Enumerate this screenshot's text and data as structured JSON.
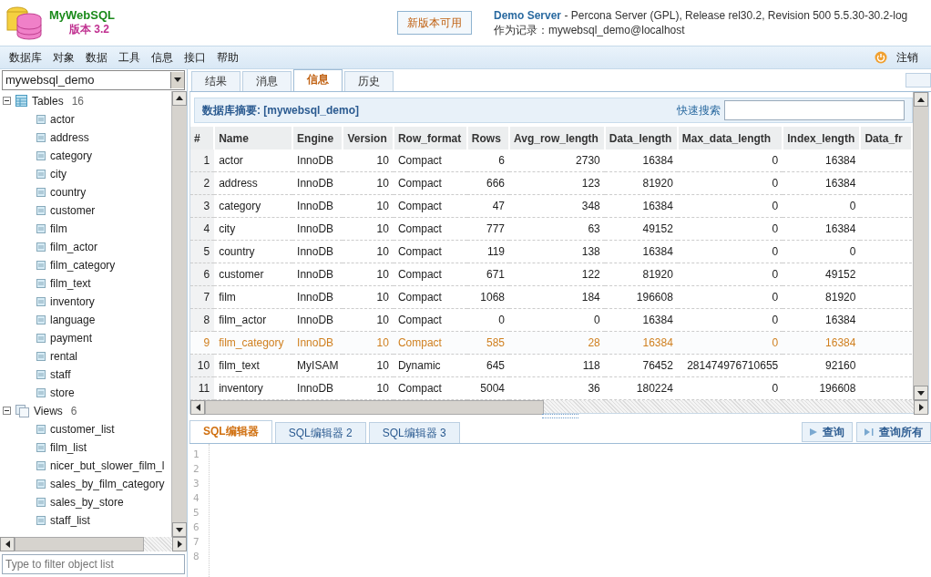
{
  "header": {
    "app_name": "MyWebSQL",
    "version": "版本 3.2",
    "update_button": "新版本可用",
    "server_name": "Demo Server",
    "server_info": "- Percona Server (GPL), Release rel30.2, Revision 500 5.5.30-30.2-log",
    "login": "作为记录：mywebsql_demo@localhost"
  },
  "menu": {
    "items": [
      "数据库",
      "对象",
      "数据",
      "工具",
      "信息",
      "接口",
      "帮助"
    ],
    "logout": "注销"
  },
  "sidebar": {
    "database": "mywebsql_demo",
    "filter_placeholder": "Type to filter object list",
    "tree": [
      {
        "label": "Tables",
        "count": "16",
        "kind": "tables",
        "expanded": true,
        "children": [
          "actor",
          "address",
          "category",
          "city",
          "country",
          "customer",
          "film",
          "film_actor",
          "film_category",
          "film_text",
          "inventory",
          "language",
          "payment",
          "rental",
          "staff",
          "store"
        ]
      },
      {
        "label": "Views",
        "count": "6",
        "kind": "views",
        "expanded": true,
        "children": [
          "customer_list",
          "film_list",
          "nicer_but_slower_film_l",
          "sales_by_film_category",
          "sales_by_store",
          "staff_list"
        ]
      }
    ]
  },
  "result_tabs": [
    {
      "label": "结果",
      "selected": false
    },
    {
      "label": "消息",
      "selected": false
    },
    {
      "label": "信息",
      "selected": true
    },
    {
      "label": "历史",
      "selected": false
    }
  ],
  "summary": {
    "title": "数据库摘要: [mywebsql_demo]",
    "quick_search_label": "快速搜索"
  },
  "table": {
    "columns": [
      "#",
      "Name",
      "Engine",
      "Version",
      "Row_format",
      "Rows",
      "Avg_row_length",
      "Data_length",
      "Max_data_length",
      "Index_length",
      "Data_fr"
    ],
    "rows": [
      {
        "selected": false,
        "cells": [
          "1",
          "actor",
          "InnoDB",
          "10",
          "Compact",
          "6",
          "2730",
          "16384",
          "0",
          "16384"
        ]
      },
      {
        "selected": false,
        "cells": [
          "2",
          "address",
          "InnoDB",
          "10",
          "Compact",
          "666",
          "123",
          "81920",
          "0",
          "16384"
        ]
      },
      {
        "selected": false,
        "cells": [
          "3",
          "category",
          "InnoDB",
          "10",
          "Compact",
          "47",
          "348",
          "16384",
          "0",
          "0"
        ]
      },
      {
        "selected": false,
        "cells": [
          "4",
          "city",
          "InnoDB",
          "10",
          "Compact",
          "777",
          "63",
          "49152",
          "0",
          "16384"
        ]
      },
      {
        "selected": false,
        "cells": [
          "5",
          "country",
          "InnoDB",
          "10",
          "Compact",
          "119",
          "138",
          "16384",
          "0",
          "0"
        ]
      },
      {
        "selected": false,
        "cells": [
          "6",
          "customer",
          "InnoDB",
          "10",
          "Compact",
          "671",
          "122",
          "81920",
          "0",
          "49152"
        ]
      },
      {
        "selected": false,
        "cells": [
          "7",
          "film",
          "InnoDB",
          "10",
          "Compact",
          "1068",
          "184",
          "196608",
          "0",
          "81920"
        ]
      },
      {
        "selected": false,
        "cells": [
          "8",
          "film_actor",
          "InnoDB",
          "10",
          "Compact",
          "0",
          "0",
          "16384",
          "0",
          "16384"
        ]
      },
      {
        "selected": true,
        "cells": [
          "9",
          "film_category",
          "InnoDB",
          "10",
          "Compact",
          "585",
          "28",
          "16384",
          "0",
          "16384"
        ]
      },
      {
        "selected": false,
        "cells": [
          "10",
          "film_text",
          "MyISAM",
          "10",
          "Dynamic",
          "645",
          "118",
          "76452",
          "281474976710655",
          "92160"
        ]
      },
      {
        "selected": false,
        "cells": [
          "11",
          "inventory",
          "InnoDB",
          "10",
          "Compact",
          "5004",
          "36",
          "180224",
          "0",
          "196608"
        ]
      }
    ]
  },
  "editor_tabs": [
    {
      "label": "SQL编辑器",
      "selected": true
    },
    {
      "label": "SQL编辑器 2",
      "selected": false
    },
    {
      "label": "SQL编辑器 3",
      "selected": false
    }
  ],
  "editor_buttons": [
    {
      "label": "查询",
      "kind": "run"
    },
    {
      "label": "查询所有",
      "kind": "run_all"
    }
  ],
  "line_numbers": [
    "1",
    "2",
    "3",
    "4",
    "5",
    "6",
    "7",
    "8"
  ]
}
